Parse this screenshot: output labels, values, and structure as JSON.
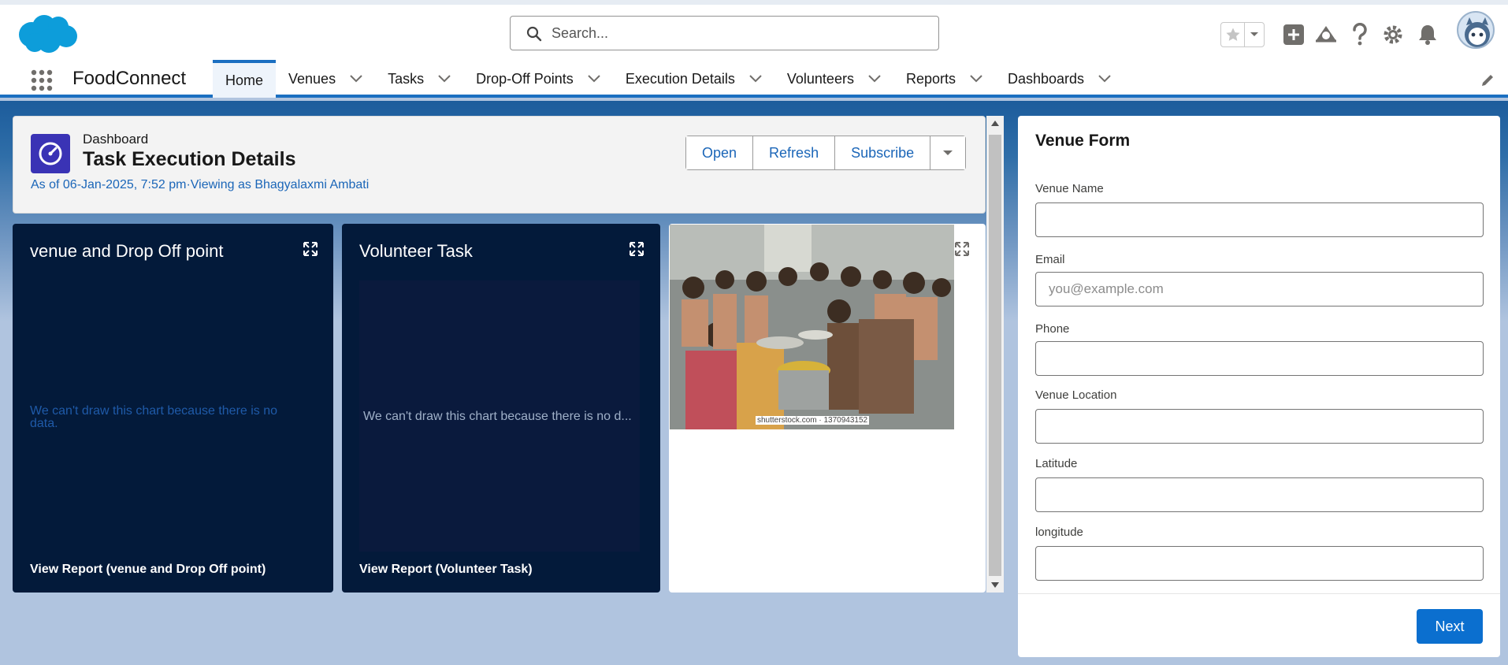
{
  "header": {
    "search": {
      "placeholder": "Search..."
    },
    "icons": [
      "salesforce-cloud-logo",
      "star-icon",
      "chevron-down-icon",
      "plus-icon",
      "trailhead-icon",
      "help-icon",
      "gear-icon",
      "bell-icon",
      "avatar-icon"
    ]
  },
  "nav": {
    "app_name": "FoodConnect",
    "tabs": [
      {
        "label": "Home",
        "active": true
      },
      {
        "label": "Venues"
      },
      {
        "label": "Tasks"
      },
      {
        "label": "Drop-Off Points"
      },
      {
        "label": "Execution Details"
      },
      {
        "label": "Volunteers"
      },
      {
        "label": "Reports"
      },
      {
        "label": "Dashboards"
      }
    ]
  },
  "dashboard": {
    "label": "Dashboard",
    "title": "Task Execution Details",
    "subtitle": "As of 06-Jan-2025, 7:52 pm·Viewing as Bhagyalaxmi Ambati",
    "buttons": {
      "open": "Open",
      "refresh": "Refresh",
      "subscribe": "Subscribe"
    }
  },
  "widgets": [
    {
      "title": "venue and Drop Off point",
      "message": "We can't draw this chart because there is no data.",
      "link": "View Report (venue and Drop Off point)"
    },
    {
      "title": "Volunteer Task",
      "message": "We can't draw this chart because there is no d...",
      "link": "View Report (Volunteer Task)"
    },
    {
      "image_credit": "shutterstock.com · 1370943152"
    }
  ],
  "form": {
    "title": "Venue Form",
    "fields": [
      {
        "label": "Venue Name",
        "value": "",
        "placeholder": ""
      },
      {
        "label": "Email",
        "value": "",
        "placeholder": "you@example.com"
      },
      {
        "label": "Phone",
        "value": "",
        "placeholder": ""
      },
      {
        "label": "Venue Location",
        "value": "",
        "placeholder": ""
      },
      {
        "label": "Latitude",
        "value": "",
        "placeholder": ""
      },
      {
        "label": "longitude",
        "value": "",
        "placeholder": ""
      }
    ],
    "next_label": "Next"
  },
  "colors": {
    "brand": "#1b6fc1",
    "dark_widget": "#031a3a",
    "link_blue": "#1b66b8",
    "dashboard_icon": "#3a33b5"
  }
}
